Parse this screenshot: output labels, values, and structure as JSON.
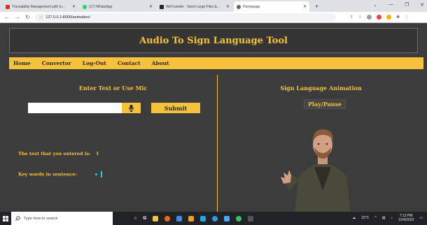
{
  "browser": {
    "tabs": [
      {
        "title": "Traceability Management with In...",
        "favicon_color": "#d93025",
        "active": false
      },
      {
        "title": "(17) WhatsApp",
        "favicon_color": "#25d366",
        "active": false
      },
      {
        "title": "WeTransfer - Send Large Files &...",
        "favicon_color": "#222222",
        "active": false
      },
      {
        "title": "Homepage",
        "favicon_color": "#5f6368",
        "active": true
      }
    ],
    "new_tab": "+",
    "url": "127.0.0.1:8000/animation/"
  },
  "page": {
    "title": "Audio To Sign Language Tool",
    "nav": [
      "Home",
      "Convertor",
      "Log-Out",
      "Contact",
      "About"
    ],
    "left": {
      "heading": "Enter Text or Use Mic",
      "input_value": "",
      "submit_label": "Submit",
      "entered_label": "The text that you entered is:",
      "entered_value": "I",
      "keywords_label": "Key words in sentence:"
    },
    "right": {
      "heading": "Sign Language Animation",
      "play_label": "Play/Pause"
    }
  },
  "taskbar": {
    "search_placeholder": "Type here to search",
    "weather": "22°C",
    "time": "7:13 PM",
    "date": "1/24/2023"
  },
  "colors": {
    "accent": "#f6c23e",
    "background": "#3c3c3c",
    "cursor": "#14d8d8"
  }
}
